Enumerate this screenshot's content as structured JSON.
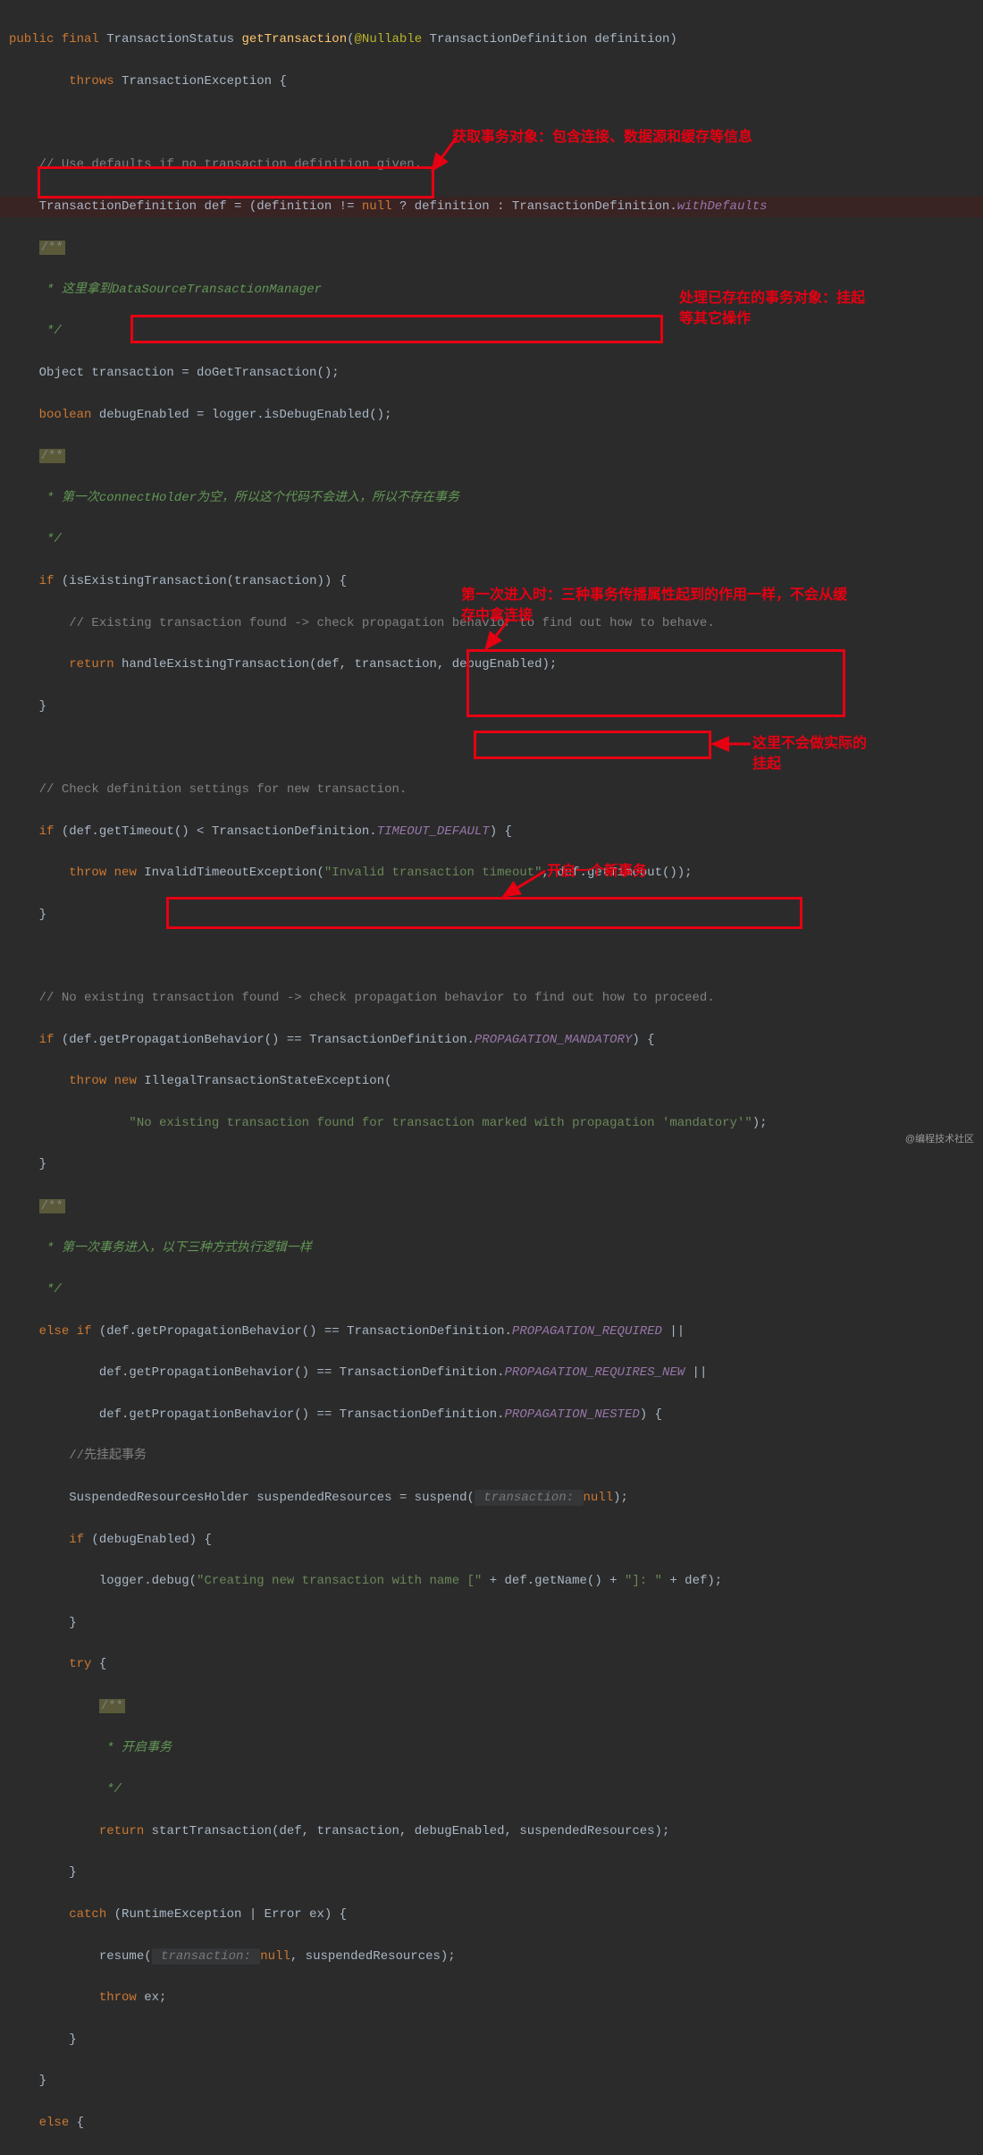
{
  "code": {
    "sig_public": "public",
    "sig_final": "final",
    "sig_ret": "TransactionStatus",
    "sig_name": "getTransaction",
    "sig_anno": "@Nullable",
    "sig_ptype": "TransactionDefinition",
    "sig_pname": "definition",
    "throws_kw": "throws",
    "throws_type": "TransactionException",
    "c_defaults": "// Use defaults if no transaction definition given.",
    "def_line_pre": "TransactionDefinition def = (definition != ",
    "null_kw": "null",
    "def_line_mid": " ? definition : TransactionDefinition.",
    "with_defaults": "withDefaults",
    "doc_open": "/**",
    "doc_body1": " * 这里拿到",
    "doc_ref1": "DataSourceTransactionManager",
    "doc_close": " */",
    "obj_line": "Object transaction = doGetTransaction();",
    "debug_line_pre": "boolean",
    "debug_line_mid": " debugEnabled = logger.isDebugEnabled();",
    "doc_body2": " * 第一次",
    "doc_ref2": "connectHolder",
    "doc_tail2": "为空，所以这个代码不会进入，所以不存在事务",
    "if_kw": "if",
    "exist_cond": " (isExistingTransaction(transaction)) {",
    "exist_comment": "// Existing transaction found -> check propagation behavior to find out how to behave.",
    "return_kw": "return",
    "handle_call": " handleExistingTransaction(def, transaction, debugEnabled);",
    "brace_close": "}",
    "c_check": "// Check definition settings for new transaction.",
    "timeout_if": " (def.getTimeout() < TransactionDefinition.",
    "timeout_const": "TIMEOUT_DEFAULT",
    "timeout_tail": ") {",
    "throw_kw": "throw",
    "new_kw": "new",
    "invalid_ex": " InvalidTimeoutException(",
    "invalid_str": "\"Invalid transaction timeout\"",
    "invalid_tail": ", def.getTimeout());",
    "c_noexist": "// No existing transaction found -> check propagation behavior to find out how to proceed.",
    "mand_if": " (def.getPropagationBehavior() == TransactionDefinition.",
    "mand_const": "PROPAGATION_MANDATORY",
    "mand_tail": ") {",
    "illegal_ex": " IllegalTransactionStateException(",
    "illegal_str": "\"No existing transaction found for transaction marked with propagation 'mandatory'\"",
    "illegal_tail": ");",
    "doc_body3": " * 第一次事务进入，以下三种方式执行逻辑一样",
    "else_kw": "else",
    "prop_if1": " (def.getPropagationBehavior() == TransactionDefinition.",
    "prop_c1": "PROPAGATION_REQUIRED",
    "prop_or": " ||",
    "prop_if2": "def.getPropagationBehavior() == TransactionDefinition.",
    "prop_c2": "PROPAGATION_REQUIRES_NEW",
    "prop_c3": "PROPAGATION_NESTED",
    "prop_tail3": ") {",
    "c_suspend": "//先挂起事务",
    "susp_line": "SuspendedResourcesHolder suspendedResources = suspend(",
    "susp_hint": " transaction: ",
    "susp_tail": ");",
    "if_debug": " (debugEnabled) {",
    "debug_log_pre": "logger.debug(",
    "debug_str1": "\"Creating new transaction with name [\"",
    "debug_mid": " + def.getName() + ",
    "debug_str2": "\"]: \"",
    "debug_tail": " + def);",
    "try_kw": "try",
    "try_tail": " {",
    "doc_body4": " * 开启事务",
    "start_call": " startTransaction(def, transaction, debugEnabled, suspendedResources);",
    "catch_kw": "catch",
    "catch_cond": " (RuntimeException | Error ex) {",
    "resume_pre": "resume(",
    "resume_tail": ", suspendedResources);",
    "throw_ex": " ex;",
    "else_tail": " {"
  },
  "annotations": {
    "a1": "获取事务对象：包含连接、数据源和缓存等信息",
    "a2_l1": "处理已存在的事务对象：挂起",
    "a2_l2": "等其它操作",
    "a3_l1": "第一次进入时：三种事务传播属性起到的作用一样，不会从缓",
    "a3_l2": "存中拿连接",
    "a4_l1": "这里不会做实际的",
    "a4_l2": "挂起",
    "a5": "开启一个新事务"
  },
  "watermark": "@编程技术社区"
}
